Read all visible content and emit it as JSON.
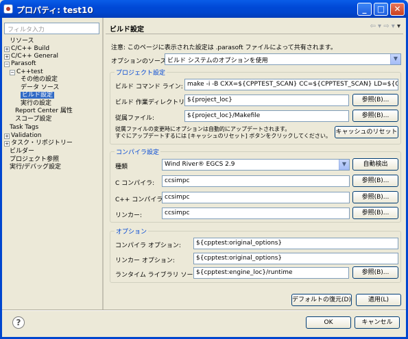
{
  "window": {
    "title": "プロパティ: test10"
  },
  "filter": {
    "placeholder": "フィルタ入力"
  },
  "tree": [
    {
      "label": "リソース",
      "expandable": false,
      "selected": false
    },
    {
      "label": "C/C++ Build",
      "expandable": true,
      "selected": false
    },
    {
      "label": "C/C++ General",
      "expandable": true,
      "selected": false
    },
    {
      "label": "Parasoft",
      "expandable": true,
      "selected": false
    },
    {
      "label": "C++test",
      "expandable": true,
      "selected": false
    },
    {
      "label": "その他の設定",
      "expandable": false,
      "selected": false
    },
    {
      "label": "データ ソース",
      "expandable": false,
      "selected": false
    },
    {
      "label": "ビルド設定",
      "expandable": false,
      "selected": true
    },
    {
      "label": "実行の設定",
      "expandable": false,
      "selected": false
    },
    {
      "label": "Report Center 属性",
      "expandable": false,
      "selected": false
    },
    {
      "label": "スコープ設定",
      "expandable": false,
      "selected": false
    },
    {
      "label": "Task Tags",
      "expandable": false,
      "selected": false
    },
    {
      "label": "Validation",
      "expandable": true,
      "selected": false
    },
    {
      "label": "タスク・リポジトリー",
      "expandable": true,
      "selected": false
    },
    {
      "label": "ビルダー",
      "expandable": false,
      "selected": false
    },
    {
      "label": "プロジェクト参照",
      "expandable": false,
      "selected": false
    },
    {
      "label": "実行/デバッグ設定",
      "expandable": false,
      "selected": false
    }
  ],
  "panel": {
    "title": "ビルド設定",
    "note": "注意: このページに表示された設定は .parasoft ファイルによって共有されます。",
    "option_source_label": "オプションのソース:",
    "option_source_value": "ビルド システムのオプションを使用"
  },
  "project_group": {
    "title": "プロジェクト設定",
    "build_command_label": "ビルド コマンド ライン:",
    "build_command_value": "make -i -B CXX=${CPPTEST_SCAN} CC=${CPPTEST_SCAN} LD=${C",
    "build_dir_label": "ビルド 作業ディレクトリ:",
    "build_dir_value": "${project_loc}",
    "dep_file_label": "従属ファイル:",
    "dep_file_value": "${project_loc}/Makefile",
    "browse_label": "参照(B)...",
    "dep_note_line1": "従属ファイルの変更時にオプションは自動的にアップデートされます。",
    "dep_note_line2": "すぐにアップデートするには [キャッシュのリセット] ボタンをクリックしてください。",
    "reset_cache_label": "キャッシュのリセット"
  },
  "compiler_group": {
    "title": "コンパイラ設定",
    "kind_label": "種類",
    "kind_value": "Wind River® EGCS 2.9",
    "auto_detect_label": "自動検出",
    "c_compiler_label": "C コンパイラ:",
    "c_compiler_value": "ccsimpc",
    "cpp_compiler_label": "C++ コンパイラ:",
    "cpp_compiler_value": "ccsimpc",
    "linker_label": "リンカー:",
    "linker_value": "ccsimpc",
    "browse_label": "参照(B)..."
  },
  "options_group": {
    "title": "オプション",
    "compiler_opt_label": "コンパイラ オプション:",
    "compiler_opt_value": "${cpptest:original_options}",
    "linker_opt_label": "リンカー オプション:",
    "linker_opt_value": "${cpptest:original_options}",
    "runtime_label": "ランタイム ライブラリ ソース:",
    "runtime_value": "${cpptest:engine_loc}/runtime",
    "browse_label": "参照(B)..."
  },
  "footer": {
    "restore_defaults_label": "デフォルトの復元(D)",
    "apply_label": "適用(L)",
    "ok_label": "OK",
    "cancel_label": "キャンセル"
  },
  "nav": {
    "back_glyph": "⇦ ▾",
    "forward_glyph": "⇨ ▾",
    "menu_glyph": "▾"
  },
  "colors": {
    "titlebar": "#0046cf",
    "group_title": "#0046d5",
    "selection": "#316ac5"
  }
}
